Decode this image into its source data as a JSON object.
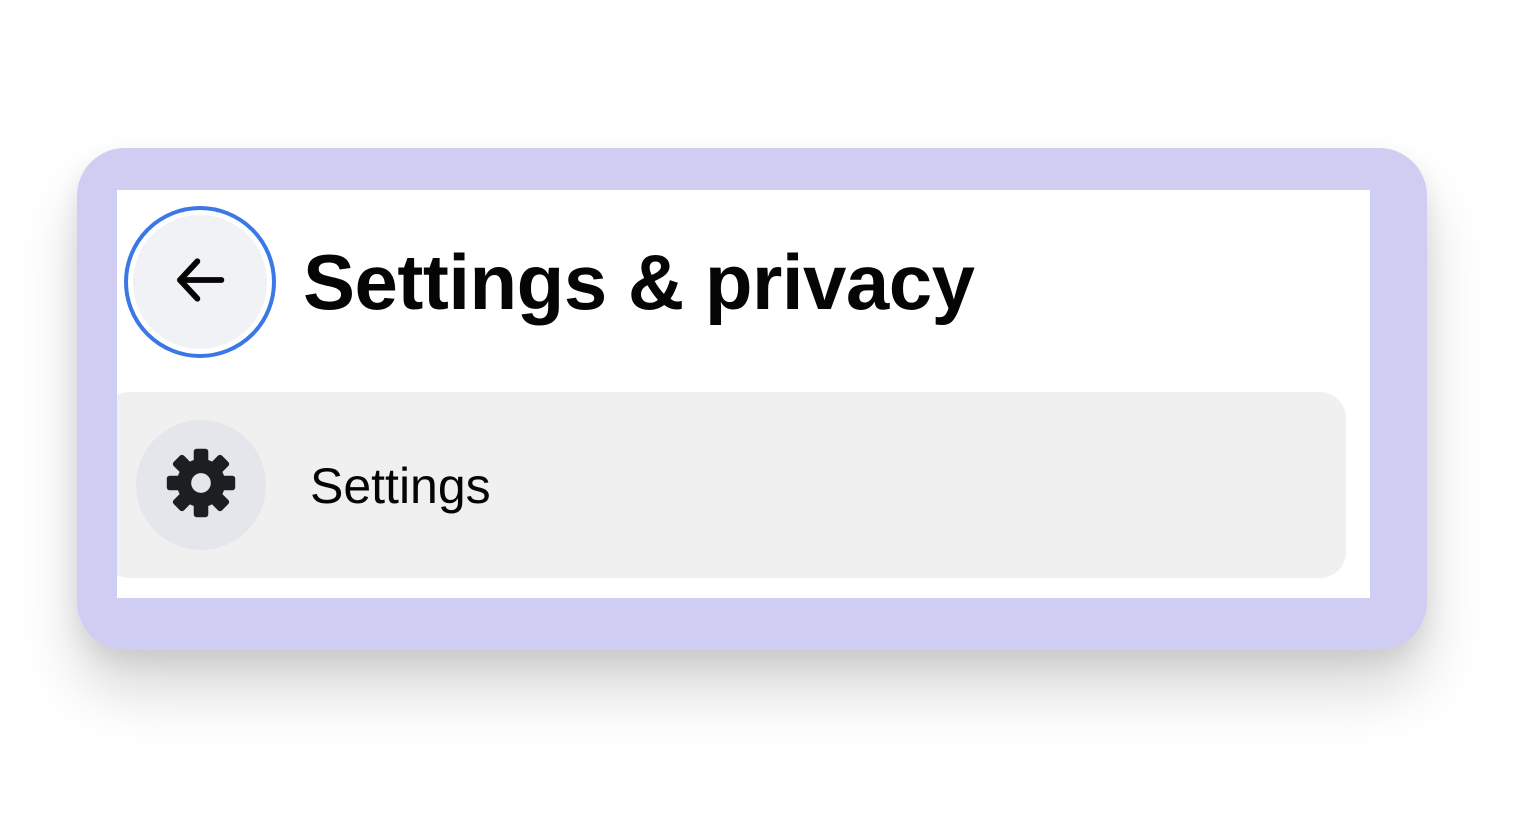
{
  "header": {
    "back_icon": "arrow-left-icon",
    "title": "Settings & privacy"
  },
  "menu": {
    "items": [
      {
        "icon": "gear-icon",
        "label": "Settings"
      }
    ]
  },
  "colors": {
    "frame": "#cfcdf2",
    "focus_ring": "#3b78e7",
    "item_background": "#f0f0f0",
    "icon_circle": "#e4e6eb",
    "text": "#050505"
  }
}
